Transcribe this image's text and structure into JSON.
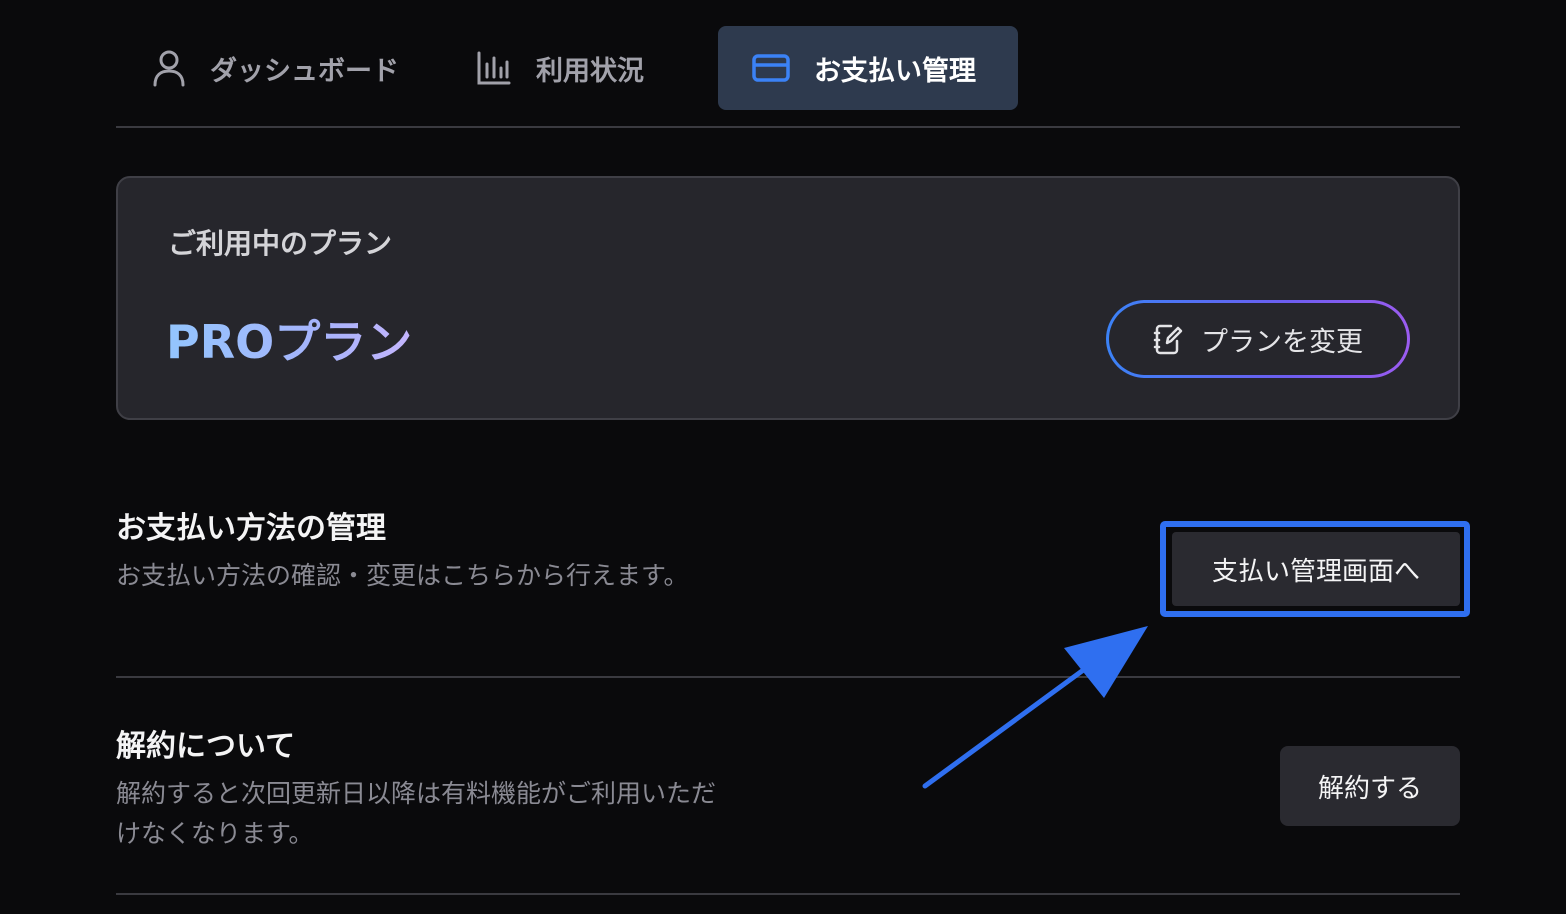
{
  "tabs": [
    {
      "label": "ダッシュボード",
      "icon": "user-icon",
      "active": false
    },
    {
      "label": "利用状況",
      "icon": "bar-chart-icon",
      "active": false
    },
    {
      "label": "お支払い管理",
      "icon": "credit-card-icon",
      "active": true
    }
  ],
  "plan": {
    "caption": "ご利用中のプラン",
    "name": "PROプラン",
    "change_button": "プランを変更",
    "change_icon": "notebook-edit-icon"
  },
  "payment": {
    "title": "お支払い方法の管理",
    "description": "お支払い方法の確認・変更はこちらから行えます。",
    "button": "支払い管理画面へ"
  },
  "cancellation": {
    "title": "解約について",
    "description": "解約すると次回更新日以降は有料機能がご利用いただけなくなります。",
    "button": "解約する"
  },
  "colors": {
    "background": "#0a0a0c",
    "card": "#26262c",
    "active_tab": "#2e3a4e",
    "accent_blue": "#2f6ff0",
    "muted_text": "#8a8a93"
  }
}
